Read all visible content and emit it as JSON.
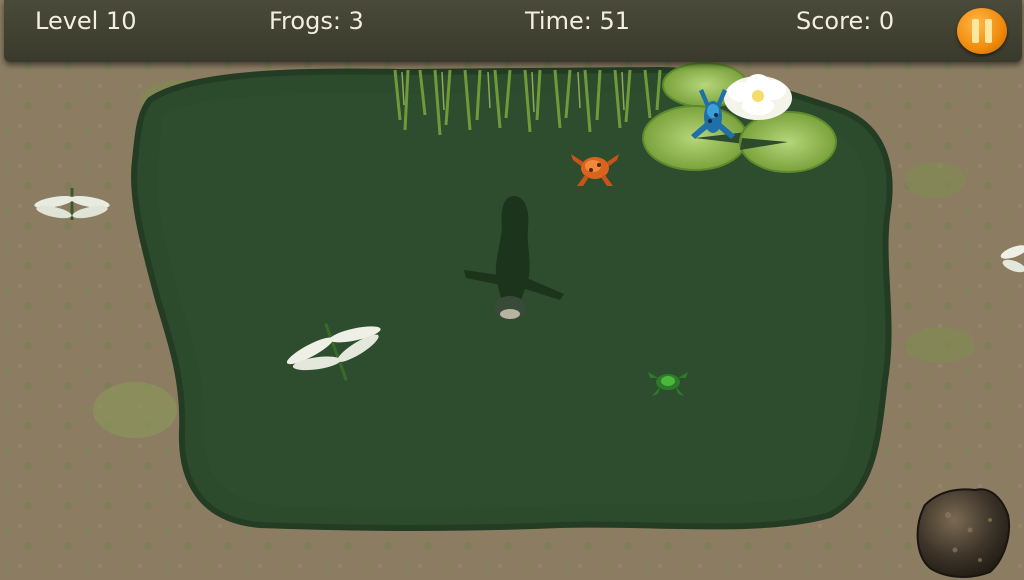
{
  "hud": {
    "level_label": "Level 10",
    "frogs_label": "Frogs: 3",
    "time_label": "Time: 51",
    "score_label": "Score: 0"
  },
  "colors": {
    "grass": "#8a7a5e",
    "pond": "#2d4a2d",
    "hud_bar": "#3f3f31",
    "pause_button": "#f08a0a",
    "text": "#f2efe2"
  },
  "icons": {
    "pause": "pause-icon",
    "frogs": [
      "blue-frog-icon",
      "orange-frog-icon",
      "green-frog-icon"
    ],
    "dragonflies": [
      "dragonfly-icon"
    ],
    "predator": "fish-icon",
    "rock": "rock-icon",
    "lily": "water-lily-icon"
  }
}
